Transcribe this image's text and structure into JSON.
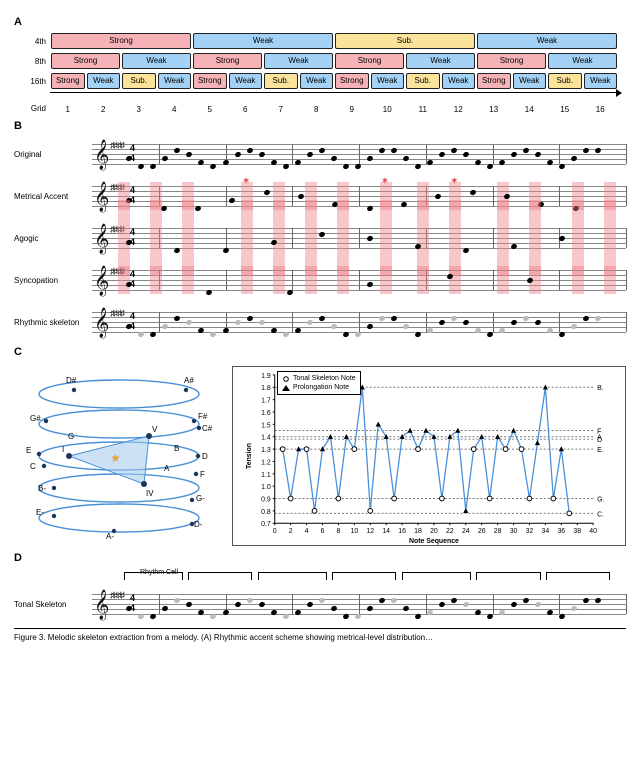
{
  "panelA": {
    "label": "A",
    "row_labels": [
      "4th",
      "8th",
      "16th"
    ],
    "grid_label": "Grid",
    "grid_numbers": [
      1,
      2,
      3,
      4,
      5,
      6,
      7,
      8,
      9,
      10,
      11,
      12,
      13,
      14,
      15,
      16
    ],
    "rows": {
      "fourth": [
        {
          "label": "Strong",
          "class": "strong",
          "span": 4
        },
        {
          "label": "Weak",
          "class": "weak",
          "span": 4
        },
        {
          "label": "Sub.",
          "class": "sub",
          "span": 4
        },
        {
          "label": "Weak",
          "class": "weak",
          "span": 4
        }
      ],
      "eighth": [
        {
          "label": "Strong",
          "class": "strong",
          "span": 2
        },
        {
          "label": "Weak",
          "class": "weak",
          "span": 2
        },
        {
          "label": "Strong",
          "class": "strong",
          "span": 2
        },
        {
          "label": "Weak",
          "class": "weak",
          "span": 2
        },
        {
          "label": "Strong",
          "class": "strong",
          "span": 2
        },
        {
          "label": "Weak",
          "class": "weak",
          "span": 2
        },
        {
          "label": "Strong",
          "class": "strong",
          "span": 2
        },
        {
          "label": "Weak",
          "class": "weak",
          "span": 2
        }
      ],
      "sixteenth": [
        {
          "label": "Strong",
          "class": "strong",
          "span": 1
        },
        {
          "label": "Weak",
          "class": "weak",
          "span": 1
        },
        {
          "label": "Sub.",
          "class": "sub",
          "span": 1
        },
        {
          "label": "Weak",
          "class": "weak",
          "span": 1
        },
        {
          "label": "Strong",
          "class": "strong",
          "span": 1
        },
        {
          "label": "Weak",
          "class": "weak",
          "span": 1
        },
        {
          "label": "Sub.",
          "class": "sub",
          "span": 1
        },
        {
          "label": "Weak",
          "class": "weak",
          "span": 1
        },
        {
          "label": "Strong",
          "class": "strong",
          "span": 1
        },
        {
          "label": "Weak",
          "class": "weak",
          "span": 1
        },
        {
          "label": "Sub.",
          "class": "sub",
          "span": 1
        },
        {
          "label": "Weak",
          "class": "weak",
          "span": 1
        },
        {
          "label": "Strong",
          "class": "strong",
          "span": 1
        },
        {
          "label": "Weak",
          "class": "weak",
          "span": 1
        },
        {
          "label": "Sub.",
          "class": "sub",
          "span": 1
        },
        {
          "label": "Weak",
          "class": "weak",
          "span": 1
        }
      ]
    }
  },
  "panelB": {
    "label": "B",
    "rows": [
      "Original",
      "Metrical Accent",
      "Agogic",
      "Syncopation",
      "Rhythmic skeleton"
    ],
    "time_signature": {
      "top": "4",
      "bottom": "4"
    },
    "sharps": "♯♯♯♯",
    "highlight_positions_pct": [
      6,
      12,
      18,
      29,
      35,
      41,
      47,
      55,
      62,
      68,
      77,
      83,
      91,
      97
    ],
    "stars_pct": [
      29,
      55,
      68
    ]
  },
  "panelC": {
    "label": "C",
    "spiral_labels": [
      "D#",
      "A#",
      "G#",
      "F#",
      "E",
      "C#",
      "G",
      "B",
      "D",
      "C",
      "A",
      "F",
      "B-",
      "E-",
      "A-",
      "G-",
      "D-"
    ],
    "chord_labels": [
      "I",
      "IV",
      "V"
    ],
    "legend": {
      "tonal": "Tonal Skeleton Note",
      "prolong": "Prolongation Note"
    },
    "axes": {
      "x": "Note Sequence",
      "y": "Tension"
    },
    "yticks": [
      0.7,
      0.8,
      0.9,
      1.0,
      1.1,
      1.2,
      1.3,
      1.4,
      1.5,
      1.6,
      1.7,
      1.8,
      1.9
    ],
    "right_ticks": [
      "C.",
      "G.",
      "E.",
      "D",
      "A",
      "F",
      "B."
    ],
    "right_tick_values": [
      0.78,
      0.9,
      1.3,
      1.38,
      1.4,
      1.45,
      1.8
    ]
  },
  "chart_data": {
    "type": "line",
    "title": "",
    "xlabel": "Note Sequence",
    "ylabel": "Tension",
    "xlim": [
      0,
      40
    ],
    "ylim": [
      0.7,
      1.9
    ],
    "x": [
      1,
      2,
      3,
      4,
      5,
      6,
      7,
      8,
      9,
      10,
      11,
      12,
      13,
      14,
      15,
      16,
      17,
      18,
      19,
      20,
      21,
      22,
      23,
      24,
      25,
      26,
      27,
      28,
      29,
      30,
      31,
      32,
      33,
      34,
      35,
      36,
      37
    ],
    "y": [
      1.3,
      0.9,
      1.3,
      1.3,
      0.8,
      1.3,
      1.4,
      0.9,
      1.4,
      1.3,
      1.8,
      0.8,
      1.5,
      1.4,
      0.9,
      1.4,
      1.45,
      1.3,
      1.45,
      1.4,
      0.9,
      1.4,
      1.45,
      0.8,
      1.3,
      1.4,
      0.9,
      1.4,
      1.3,
      1.45,
      1.3,
      0.9,
      1.35,
      1.8,
      0.9,
      1.3,
      0.78
    ],
    "point_class": [
      "t",
      "t",
      "p",
      "t",
      "t",
      "p",
      "p",
      "t",
      "p",
      "t",
      "p",
      "t",
      "p",
      "p",
      "t",
      "p",
      "p",
      "t",
      "p",
      "p",
      "t",
      "p",
      "p",
      "p",
      "t",
      "p",
      "t",
      "p",
      "t",
      "p",
      "t",
      "t",
      "p",
      "p",
      "t",
      "p",
      "t"
    ],
    "reference_lines": [
      0.78,
      0.9,
      1.3,
      1.38,
      1.4,
      1.45,
      1.8
    ]
  },
  "panelD": {
    "label": "D",
    "rows": [
      "Tonal Skeleton"
    ],
    "rhythm_cell_label": "Rhythm Cell",
    "bracket_spans_pct": [
      [
        6,
        17
      ],
      [
        18,
        30
      ],
      [
        31,
        44
      ],
      [
        45,
        57
      ],
      [
        58,
        71
      ],
      [
        72,
        84
      ],
      [
        85,
        97
      ]
    ]
  },
  "caption": "Figure 3. Melodic skeleton extraction from a melody. (A) Rhythmic accent scheme showing metrical-level distribution…"
}
